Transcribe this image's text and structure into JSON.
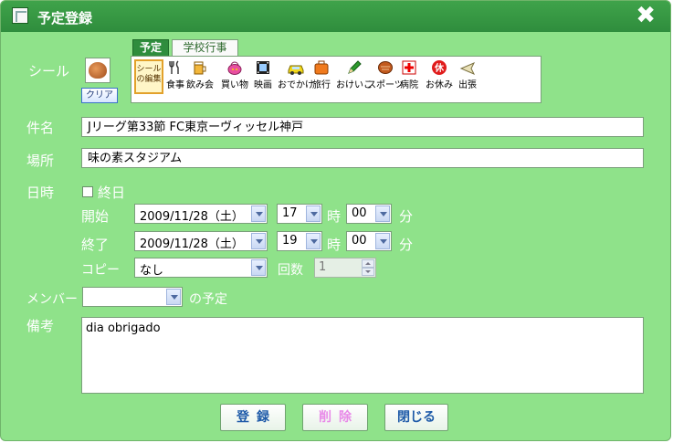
{
  "window": {
    "title": "予定登録"
  },
  "seal": {
    "label": "シール",
    "clear_label": "クリア",
    "tabs": [
      {
        "label": "予定"
      },
      {
        "label": "学校行事"
      }
    ],
    "edit_label": "シールの編集",
    "items": [
      {
        "label": "食事",
        "icon": "fork-knife-icon"
      },
      {
        "label": "飲み会",
        "icon": "beer-icon"
      },
      {
        "label": "買い物",
        "icon": "shopping-bag-icon"
      },
      {
        "label": "映画",
        "icon": "film-icon"
      },
      {
        "label": "おでかけ",
        "icon": "car-icon"
      },
      {
        "label": "旅行",
        "icon": "suitcase-icon"
      },
      {
        "label": "おけいこ",
        "icon": "pencil-icon"
      },
      {
        "label": "スポーツ",
        "icon": "glove-icon"
      },
      {
        "label": "病院",
        "icon": "hospital-cross-icon"
      },
      {
        "label": "お休み",
        "icon": "rest-badge-icon"
      },
      {
        "label": "出張",
        "icon": "airplane-icon"
      }
    ]
  },
  "subject": {
    "label": "件名",
    "value": "Jリーグ第33節  FC東京ーヴィッセル神戸"
  },
  "place": {
    "label": "場所",
    "value": "味の素スタジアム"
  },
  "datetime": {
    "label": "日時",
    "allday_label": "終日",
    "allday_checked": false,
    "start": {
      "label": "開始",
      "date": "2009/11/28（土）",
      "hour": "17",
      "minute": "00"
    },
    "end": {
      "label": "終了",
      "date": "2009/11/28（土）",
      "hour": "19",
      "minute": "00"
    },
    "hour_unit": "時",
    "minute_unit": "分",
    "copy": {
      "label": "コピー",
      "value": "なし",
      "count_label": "回数",
      "count": "1"
    }
  },
  "member": {
    "label": "メンバー",
    "value": "",
    "suffix": "の予定"
  },
  "memo": {
    "label": "備考",
    "value": "dia obrigado"
  },
  "buttons": {
    "register": "登録",
    "delete": "削除",
    "close": "閉じる"
  },
  "colors": {
    "window_bg": "#8fe28a",
    "titlebar": "#2f8d3d",
    "label_text": "#ffffff",
    "register_text": "#1e5aa8",
    "delete_text": "#e88ae8"
  }
}
